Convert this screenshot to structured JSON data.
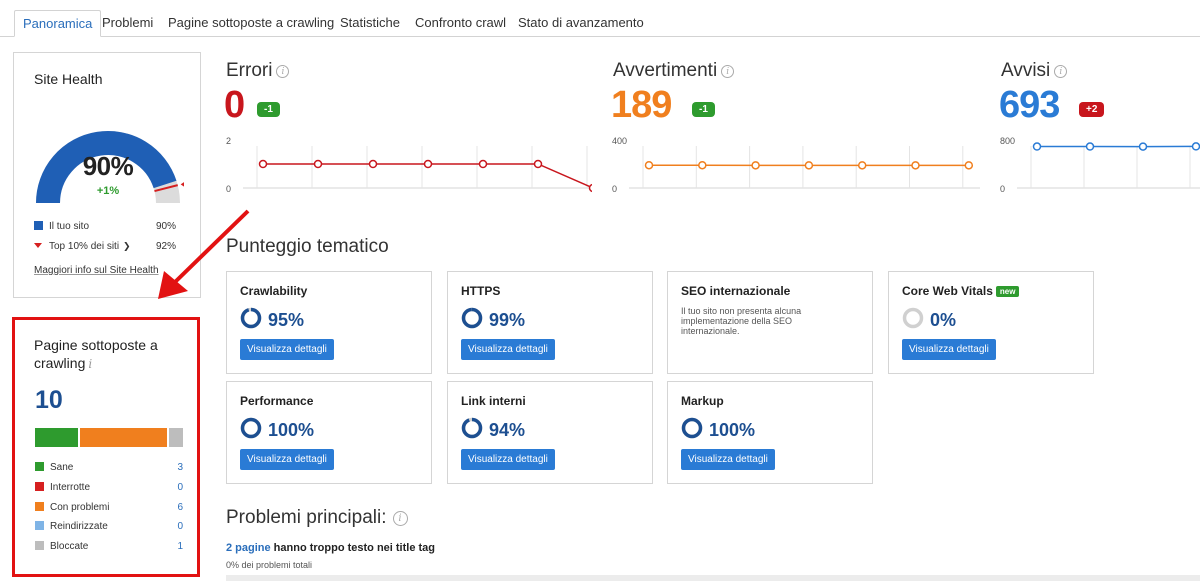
{
  "tabs": [
    {
      "label": "Panoramica",
      "active": true
    },
    {
      "label": "Problemi"
    },
    {
      "label": "Pagine sottoposte a crawling"
    },
    {
      "label": "Statistiche"
    },
    {
      "label": "Confronto crawl"
    },
    {
      "label": "Stato di avanzamento"
    }
  ],
  "site_health": {
    "title": "Site Health",
    "percent": "90%",
    "percent_value": 90,
    "top10_value": 92,
    "delta": "+1%",
    "legend": [
      {
        "label": "Il tuo sito",
        "value": "90%"
      },
      {
        "label": "Top 10% dei siti",
        "value": "92%"
      }
    ],
    "link": "Maggiori info sul Site Health",
    "colors": {
      "gauge": "#1f5fb5",
      "track": "#dcdcdc",
      "marker": "#d62020"
    }
  },
  "crawled": {
    "title": "Pagine sottoposte a crawling",
    "count": "10",
    "legend": [
      {
        "label": "Sane",
        "value": "3",
        "color": "#2e9b2e",
        "pages": 3
      },
      {
        "label": "Interrotte",
        "value": "0",
        "color": "#d62020",
        "pages": 0
      },
      {
        "label": "Con problemi",
        "value": "6",
        "color": "#f07f1e",
        "pages": 6
      },
      {
        "label": "Reindirizzate",
        "value": "0",
        "color": "#7fb4e6",
        "pages": 0
      },
      {
        "label": "Bloccate",
        "value": "1",
        "color": "#bdbdbd",
        "pages": 1
      }
    ]
  },
  "metrics": [
    {
      "title": "Errori",
      "value": "0",
      "badge": "-1",
      "badge_color": "#2e9b2e",
      "value_color": "#c8161d",
      "line_color": "#c8161d",
      "y_max_label": "2",
      "y_min_label": "0",
      "y_max": 2,
      "series": [
        1,
        1,
        1,
        1,
        1,
        1,
        0
      ]
    },
    {
      "title": "Avvertimenti",
      "value": "189",
      "badge": "-1",
      "badge_color": "#2e9b2e",
      "value_color": "#f07f1e",
      "line_color": "#f07f1e",
      "y_max_label": "400",
      "y_min_label": "0",
      "y_max": 400,
      "series": [
        190,
        190,
        189,
        189,
        189,
        189,
        189
      ]
    },
    {
      "title": "Avvisi",
      "value": "693",
      "badge": "+2",
      "badge_color": "#c8161d",
      "value_color": "#2a7bd5",
      "line_color": "#2a7bd5",
      "y_max_label": "800",
      "y_min_label": "0",
      "y_max": 800,
      "series": [
        691,
        691,
        690,
        693
      ]
    }
  ],
  "thematic": {
    "title": "Punteggio tematico",
    "button_label": "Visualizza dettagli",
    "cards": [
      {
        "title": "Crawlability",
        "pct": "95%",
        "value": 95
      },
      {
        "title": "HTTPS",
        "pct": "99%",
        "value": 99
      },
      {
        "title": "SEO internazionale",
        "desc": "Il tuo sito non presenta alcuna implementazione della SEO internazionale."
      },
      {
        "title": "Core Web Vitals",
        "new": "new",
        "pct": "0%",
        "value": 0
      },
      {
        "title": "Performance",
        "pct": "100%",
        "value": 100
      },
      {
        "title": "Link interni",
        "pct": "94%",
        "value": 94
      },
      {
        "title": "Markup",
        "pct": "100%",
        "value": 100
      }
    ]
  },
  "problems": {
    "title": "Problemi principali:",
    "item_link": "2 pagine",
    "item_text": " hanno troppo testo nei title tag",
    "item_sub": "0% dei problemi totali"
  }
}
